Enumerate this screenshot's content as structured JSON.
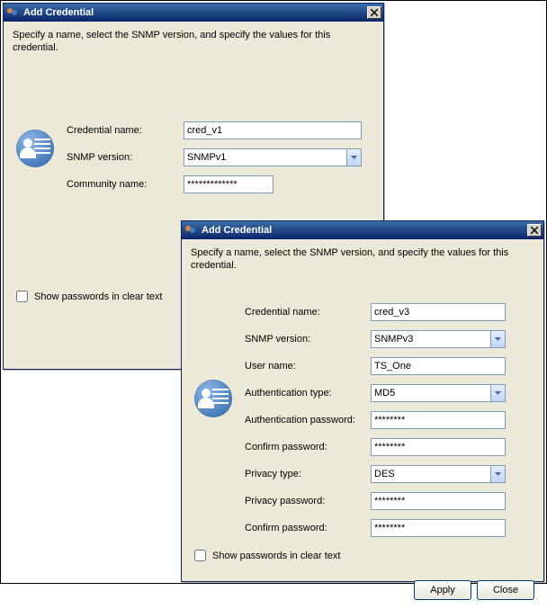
{
  "dialog1": {
    "title": "Add Credential",
    "description": "Specify a name, select the SNMP version, and specify the values for this credential.",
    "labels": {
      "credential_name": "Credential name:",
      "snmp_version": "SNMP version:",
      "community_name": "Community name:"
    },
    "values": {
      "credential_name": "cred_v1",
      "snmp_version": "SNMPv1",
      "community_name": "*************"
    },
    "show_passwords_label": "Show passwords in clear text"
  },
  "dialog2": {
    "title": "Add Credential",
    "description": "Specify a name, select the SNMP version, and specify the values for this credential.",
    "labels": {
      "credential_name": "Credential name:",
      "snmp_version": "SNMP version:",
      "user_name": "User name:",
      "auth_type": "Authentication type:",
      "auth_password": "Authentication password:",
      "confirm_password_a": "Confirm password:",
      "privacy_type": "Privacy type:",
      "privacy_password": "Privacy password:",
      "confirm_password_p": "Confirm password:"
    },
    "values": {
      "credential_name": "cred_v3",
      "snmp_version": "SNMPv3",
      "user_name": "TS_One",
      "auth_type": "MD5",
      "auth_password": "********",
      "confirm_password_a": "********",
      "privacy_type": "DES",
      "privacy_password": "********",
      "confirm_password_p": "********"
    },
    "show_passwords_label": "Show passwords in clear text",
    "buttons": {
      "apply": "Apply",
      "close": "Close"
    }
  }
}
